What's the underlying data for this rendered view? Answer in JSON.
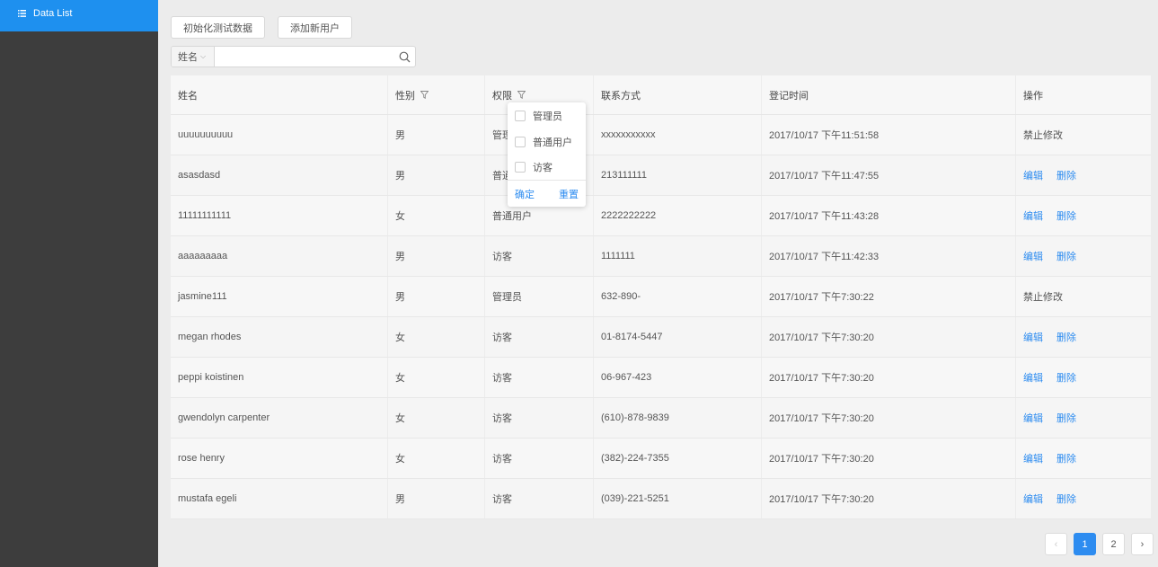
{
  "sidebar": {
    "items": [
      {
        "label": "Data List"
      }
    ]
  },
  "toolbar": {
    "init_label": "初始化测试数据",
    "add_label": "添加新用户"
  },
  "search": {
    "field": "姓名",
    "value": "",
    "placeholder": ""
  },
  "table": {
    "headers": [
      "姓名",
      "性别",
      "权限",
      "联系方式",
      "登记时间",
      "操作"
    ],
    "rows": [
      {
        "name": "uuuuuuuuuu",
        "gender": "男",
        "role": "管理员",
        "contact": "xxxxxxxxxxx",
        "time": "2017/10/17 下午11:51:58",
        "action": "disabled"
      },
      {
        "name": "asasdasd",
        "gender": "男",
        "role": "普通用户",
        "contact": "213111111",
        "time": "2017/10/17 下午11:47:55",
        "action": "edit"
      },
      {
        "name": "11111111111",
        "gender": "女",
        "role": "普通用户",
        "contact": "2222222222",
        "time": "2017/10/17 下午11:43:28",
        "action": "edit"
      },
      {
        "name": "aaaaaaaaa",
        "gender": "男",
        "role": "访客",
        "contact": "1111111",
        "time": "2017/10/17 下午11:42:33",
        "action": "edit"
      },
      {
        "name": "jasmine111",
        "gender": "男",
        "role": "管理员",
        "contact": "632-890-",
        "time": "2017/10/17 下午7:30:22",
        "action": "disabled"
      },
      {
        "name": "megan rhodes",
        "gender": "女",
        "role": "访客",
        "contact": "01-8174-5447",
        "time": "2017/10/17 下午7:30:20",
        "action": "edit"
      },
      {
        "name": "peppi koistinen",
        "gender": "女",
        "role": "访客",
        "contact": "06-967-423",
        "time": "2017/10/17 下午7:30:20",
        "action": "edit"
      },
      {
        "name": "gwendolyn carpenter",
        "gender": "女",
        "role": "访客",
        "contact": "(610)-878-9839",
        "time": "2017/10/17 下午7:30:20",
        "action": "edit"
      },
      {
        "name": "rose henry",
        "gender": "女",
        "role": "访客",
        "contact": "(382)-224-7355",
        "time": "2017/10/17 下午7:30:20",
        "action": "edit"
      },
      {
        "name": "mustafa egeli",
        "gender": "男",
        "role": "访客",
        "contact": "(039)-221-5251",
        "time": "2017/10/17 下午7:30:20",
        "action": "edit"
      }
    ],
    "action_labels": {
      "edit": "编辑",
      "delete": "删除",
      "disabled": "禁止修改"
    }
  },
  "filter_dropdown": {
    "options": [
      "管理员",
      "普通用户",
      "访客"
    ],
    "confirm": "确定",
    "reset": "重置"
  },
  "pagination": {
    "prev": "‹",
    "next": "›",
    "pages": [
      "1",
      "2"
    ],
    "current": "1"
  },
  "colors": {
    "accent": "#2d8cf0",
    "sidebar_active": "#1e90ef",
    "sidebar_bg": "#3d3d3d"
  }
}
